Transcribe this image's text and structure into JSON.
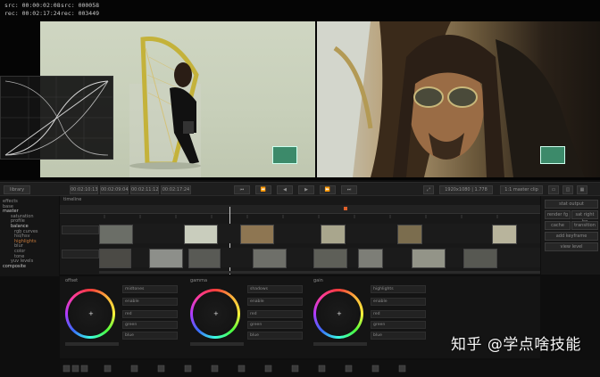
{
  "viewer": {
    "src_tc": "src: 00:00:02:08",
    "rec_tc": "rec: 00:02:17:24",
    "src_frame": "src: 000058",
    "rec_frame": "rec: 003449"
  },
  "toolbar": {
    "library": "library",
    "tc1": "00:02:10:13",
    "tc2": "00:02:09:04",
    "tc3": "00:02:11:12",
    "tc4": "00:02:17:24",
    "res": "1920x1080 | 1.778",
    "mode": "1:1 master clip"
  },
  "tree": {
    "items": [
      "effects",
      "base",
      "master",
      "saturation",
      "profile",
      "balance",
      "rgb curves",
      "hsl/hsv",
      "highlights",
      "blur",
      "color",
      "tone",
      "yuv levels",
      "composite"
    ]
  },
  "timeline": {
    "track_label": "timeline"
  },
  "right_panel": {
    "buttons": [
      "stat output",
      "render fg",
      "sat right bg",
      "cache",
      "transition",
      "add keyframe",
      "view level"
    ]
  },
  "color_sections": [
    {
      "title": "offset",
      "header": "midtones"
    },
    {
      "title": "gamma",
      "header": "shadows"
    },
    {
      "title": "gain",
      "header": "highlights"
    }
  ],
  "channels": [
    "red",
    "green",
    "blue"
  ],
  "field_labels": {
    "enable": "enable",
    "zero": "0"
  },
  "watermark": "知乎 @学点啥技能"
}
